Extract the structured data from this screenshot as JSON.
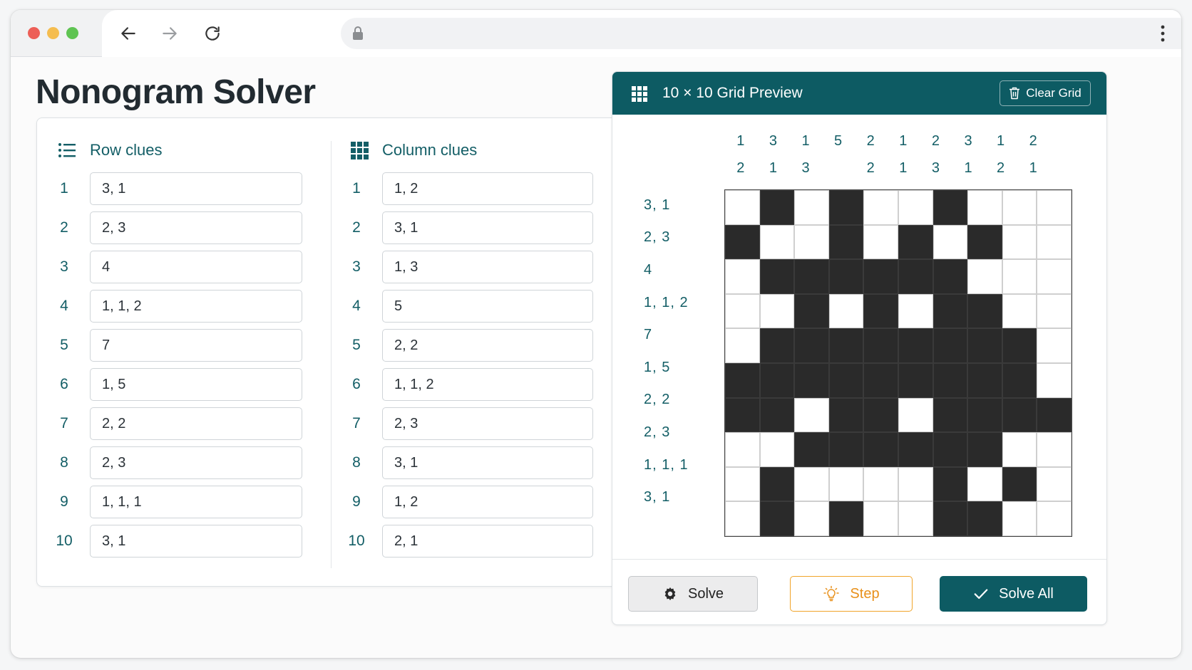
{
  "page": {
    "title": "Nonogram Solver"
  },
  "browser": {
    "icons": [
      "back-arrow-icon",
      "forward-arrow-icon",
      "reload-icon",
      "lock-icon",
      "star-icon",
      "kebab-menu-icon"
    ]
  },
  "clues": {
    "rows_header": "Row clues",
    "cols_header": "Column clues",
    "rows": [
      {
        "n": "1",
        "v": "3, 1"
      },
      {
        "n": "2",
        "v": "2, 3"
      },
      {
        "n": "3",
        "v": "4"
      },
      {
        "n": "4",
        "v": "1, 1, 2"
      },
      {
        "n": "5",
        "v": "7"
      },
      {
        "n": "6",
        "v": "1, 5"
      },
      {
        "n": "7",
        "v": "2, 2"
      },
      {
        "n": "8",
        "v": "2, 3"
      },
      {
        "n": "9",
        "v": "1, 1, 1"
      },
      {
        "n": "10",
        "v": "3, 1"
      }
    ],
    "cols": [
      {
        "n": "1",
        "v": "1, 2"
      },
      {
        "n": "2",
        "v": "3, 1"
      },
      {
        "n": "3",
        "v": "1, 3"
      },
      {
        "n": "4",
        "v": "5"
      },
      {
        "n": "5",
        "v": "2, 2"
      },
      {
        "n": "6",
        "v": "1, 1, 2"
      },
      {
        "n": "7",
        "v": "2, 3"
      },
      {
        "n": "8",
        "v": "3, 1"
      },
      {
        "n": "9",
        "v": "1, 2"
      },
      {
        "n": "10",
        "v": "2, 1"
      }
    ]
  },
  "preview": {
    "title": "10 × 10 Grid Preview",
    "clear_label": "Clear Grid",
    "col_clues_top": [
      "1",
      "3",
      "1",
      "5",
      "2",
      "1",
      "2",
      "3",
      "1",
      "2"
    ],
    "col_clues_bottom": [
      "2",
      "1",
      "3",
      "",
      "2",
      "1",
      "3",
      "1",
      "2",
      "1"
    ],
    "row_clues": [
      "3, 1",
      "2, 3",
      "4",
      "1, 1, 2",
      "7",
      "1, 5",
      "2, 2",
      "2, 3",
      "1, 1, 1",
      "3, 1"
    ],
    "cells": [
      [
        0,
        1,
        0,
        1,
        0,
        0,
        1,
        0,
        0,
        0
      ],
      [
        1,
        0,
        0,
        1,
        0,
        1,
        0,
        1,
        0,
        0
      ],
      [
        0,
        1,
        1,
        1,
        1,
        1,
        1,
        0,
        0,
        0
      ],
      [
        0,
        0,
        1,
        0,
        1,
        0,
        1,
        1,
        0,
        0
      ],
      [
        0,
        1,
        1,
        1,
        1,
        1,
        1,
        1,
        1,
        0
      ],
      [
        1,
        1,
        1,
        1,
        1,
        1,
        1,
        1,
        1,
        0
      ],
      [
        1,
        1,
        0,
        1,
        1,
        0,
        1,
        1,
        1,
        1
      ],
      [
        0,
        0,
        1,
        1,
        1,
        1,
        1,
        1,
        0,
        0
      ],
      [
        0,
        1,
        0,
        0,
        0,
        0,
        1,
        0,
        1,
        0
      ],
      [
        0,
        1,
        0,
        1,
        0,
        0,
        1,
        1,
        0,
        0
      ]
    ],
    "buttons": {
      "solve": "Solve",
      "step": "Step",
      "solve_all": "Solve All"
    }
  },
  "colors": {
    "accent": "#0d5b63",
    "step": "#e8901a",
    "filled_cell": "#2a2a2a"
  }
}
